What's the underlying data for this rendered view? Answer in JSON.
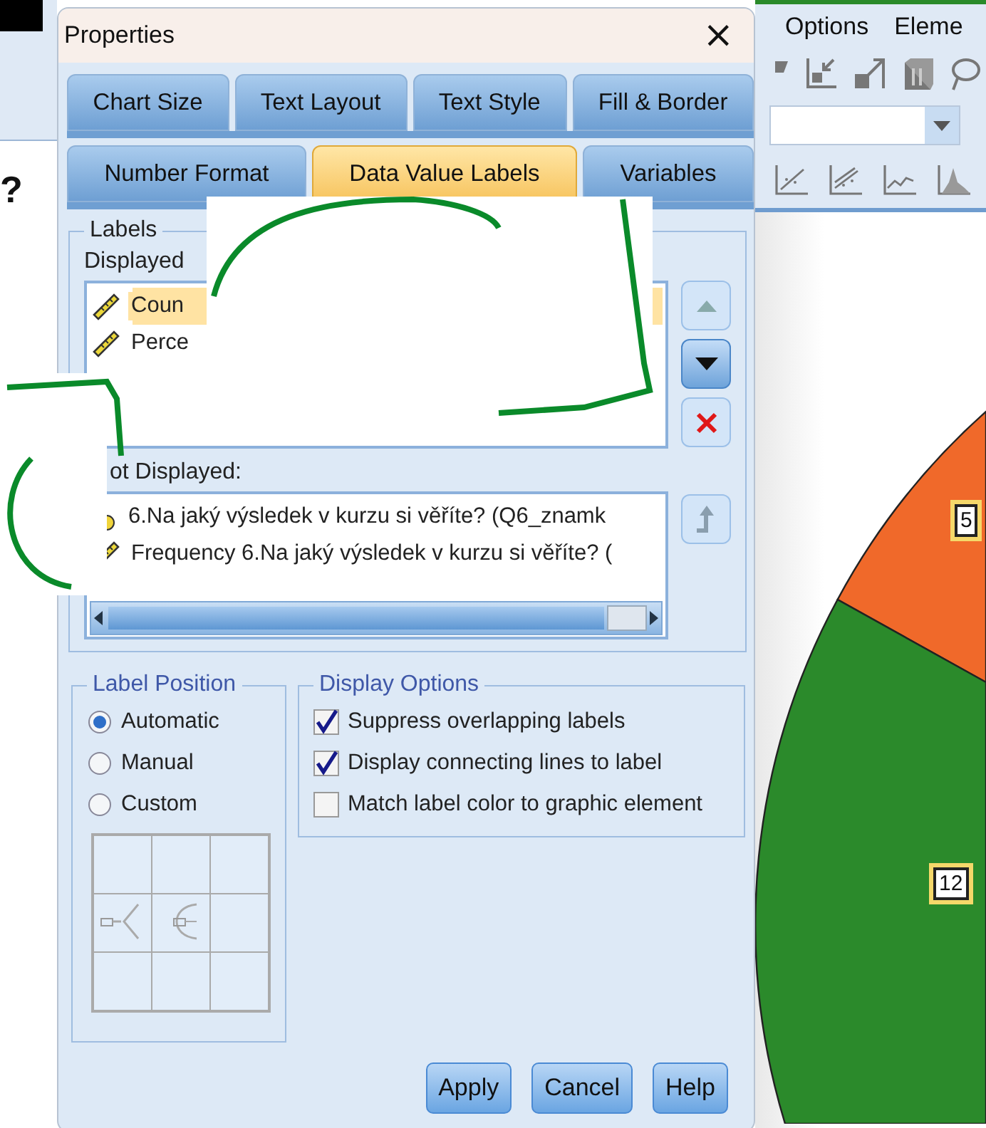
{
  "editor": {
    "menu": [
      {
        "label": "Options"
      },
      {
        "label": "Eleme"
      }
    ],
    "heading_fragment": "?",
    "chart": {
      "value_labels": [
        "5",
        "12"
      ]
    }
  },
  "dialog": {
    "title": "Properties",
    "close": "×",
    "tab_rows": [
      [
        {
          "label": "Chart Size",
          "selected": false
        },
        {
          "label": "Text Layout",
          "selected": false
        },
        {
          "label": "Text Style",
          "selected": false
        },
        {
          "label": "Fill & Border",
          "selected": false
        }
      ],
      [
        {
          "label": "Number Format",
          "selected": false
        },
        {
          "label": "Data Value Labels",
          "selected": true
        },
        {
          "label": "Variables",
          "selected": false
        }
      ]
    ],
    "labels": {
      "title": "Labels",
      "displayed_label": "Displayed",
      "displayed": [
        {
          "text": "Coun",
          "selected": true
        },
        {
          "text": "Perce",
          "selected": false
        }
      ],
      "not_displayed_label": "ot Displayed:",
      "not_displayed": [
        {
          "text": "6.Na jaký výsledek v kurzu si věříte? (Q6_znamk",
          "kind": "variable"
        },
        {
          "text": "Frequency 6.Na jaký výsledek v kurzu si věříte? (",
          "kind": "statistic"
        }
      ]
    },
    "label_position": {
      "title": "Label Position",
      "options": [
        {
          "label": "Automatic",
          "selected": true
        },
        {
          "label": "Manual",
          "selected": false
        },
        {
          "label": "Custom",
          "selected": false
        }
      ]
    },
    "display_options": {
      "title": "Display Options",
      "options": [
        {
          "label": "Suppress overlapping labels",
          "checked": true
        },
        {
          "label": "Display connecting lines to label",
          "checked": true
        },
        {
          "label": "Match label color to graphic element",
          "checked": false
        }
      ]
    },
    "buttons": [
      {
        "label": "Apply"
      },
      {
        "label": "Cancel"
      },
      {
        "label": "Help"
      }
    ]
  }
}
